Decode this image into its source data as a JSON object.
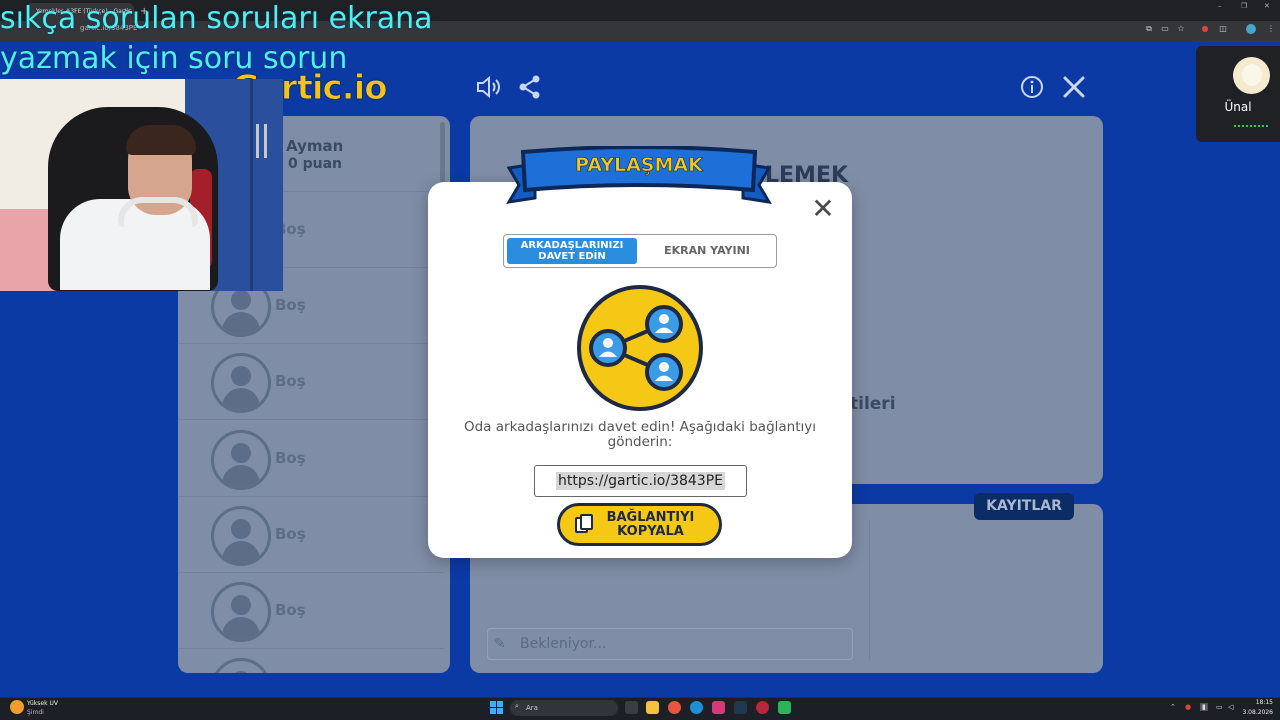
{
  "browser": {
    "tab_title": "Yemekler #3FE (Türkçe) - Gartic",
    "url": "gartic.io/3843PE",
    "tab_close": "×",
    "tab_new": "+",
    "window_minimize": "–",
    "window_restore": "❐",
    "window_close": "✕"
  },
  "overlay_text": {
    "line1": "sıkça sorulan soruları ekrana",
    "line2": "yazmak  için soru sorun"
  },
  "app": {
    "logo": "Gartic.io",
    "sound_icon": "speaker-icon",
    "share_icon": "share-icon",
    "info_icon": "info-icon",
    "close_icon": "close-icon"
  },
  "players": {
    "first": {
      "name": "Ayman",
      "points": "0 puan"
    },
    "empty_label": "Boş",
    "empty_rows": [
      "Boş",
      "Boş",
      "Boş",
      "Boş",
      "Boş",
      "Boş"
    ]
  },
  "main": {
    "ghost_title": "LEMEK",
    "ghost_text": "tileri"
  },
  "chat": {
    "records_tab": "KAYITLAR",
    "wait_placeholder": "Bekleniyor..."
  },
  "modal": {
    "title": "PAYLAŞMAK",
    "close": "✕",
    "tab_invite": "ARKADAŞLARINIZI DAVET EDİN",
    "tab_stream": "EKRAN YAYINI",
    "invite_text": "Oda arkadaşlarınızı davet edin! Aşağıdaki bağlantıyı gönderin:",
    "link": "https://gartic.io/3843PE",
    "copy_button": "BAĞLANTIYI KOPYALA",
    "colors": {
      "accent": "#f6c816",
      "tab_active": "#2a8de0",
      "ribbon": "#1e6fd8"
    }
  },
  "meet": {
    "participant": "Ünal"
  },
  "taskbar": {
    "weather_title": "Yüksek UV",
    "weather_sub": "Şimdi",
    "search_placeholder": "Ara",
    "time": "18:15",
    "date": "3.08.2026"
  }
}
